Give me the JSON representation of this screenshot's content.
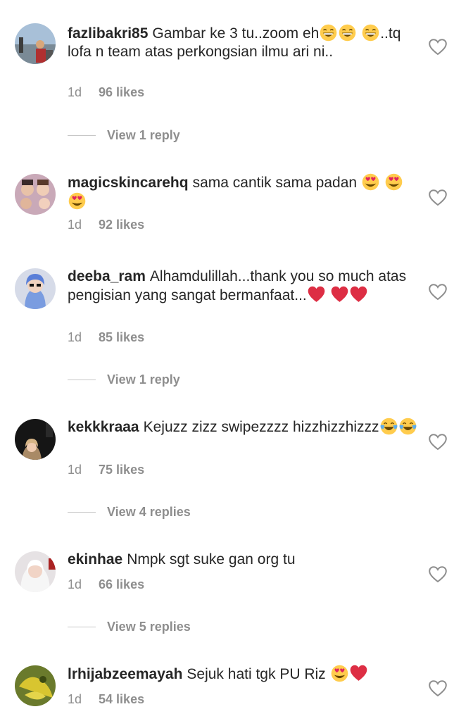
{
  "comments": [
    {
      "username": "fazlibakri85",
      "text_1": "Gambar ke 3 tu..zoom eh",
      "text_2": "..tq  lofa n team atas perkongsian ilmu ari ni..",
      "time": "1d",
      "likes": "96 likes",
      "replies": "View 1 reply"
    },
    {
      "username": "magicskincarehq",
      "text_1": "sama cantik sama padan",
      "time": "1d",
      "likes": "92 likes"
    },
    {
      "username": "deeba_ram",
      "text_1": "Alhamdulillah...thank you so much atas pengisian yang sangat bermanfaat...",
      "time": "1d",
      "likes": "85 likes",
      "replies": "View 1 reply"
    },
    {
      "username": "kekkkraaa",
      "text_1": "Kejuzz zizz swipezzzz hizzhizzhizzz",
      "time": "1d",
      "likes": "75 likes",
      "replies": "View 4 replies"
    },
    {
      "username": "ekinhae",
      "text_1": "Nmpk sgt suke gan org tu",
      "time": "1d",
      "likes": "66 likes",
      "replies": "View 5 replies"
    },
    {
      "username": "lrhijabzeemayah",
      "text_1": "Sejuk hati tgk PU Riz",
      "time": "1d",
      "likes": "54 likes"
    }
  ],
  "icons": {
    "like": "heart-outline-icon",
    "grin": "grinning-face-emoji",
    "heart_eyes": "heart-eyes-emoji",
    "red_heart": "red-heart-emoji",
    "tears_of_joy": "tears-of-joy-emoji"
  },
  "colors": {
    "text": "#262626",
    "secondary": "#8e8e8e",
    "divider": "#c7c7c7",
    "heart_red": "#e0245e"
  }
}
